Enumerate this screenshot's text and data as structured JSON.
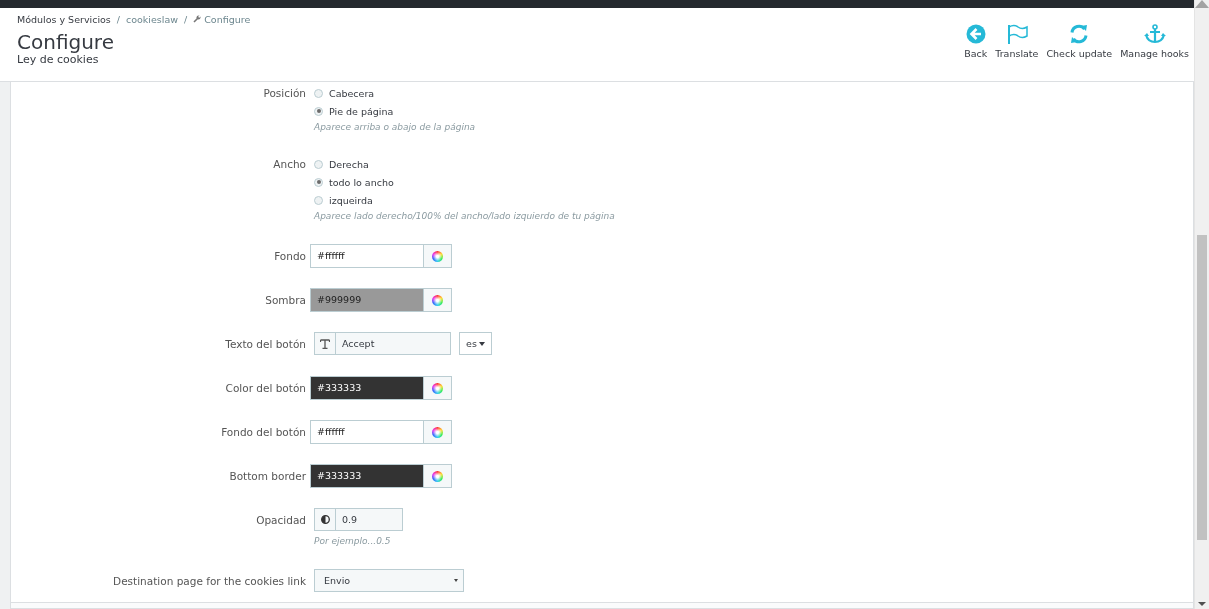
{
  "breadcrumb": [
    {
      "label": "Módulos y Servicios"
    },
    {
      "separator": "/",
      "label": "cookieslaw"
    },
    {
      "separator": "/",
      "label": "Configure",
      "kind": "wrench"
    }
  ],
  "page_title": "Configure",
  "page_subtitle": "Ley de cookies",
  "toolbar": [
    {
      "label": "Back",
      "kind": "back"
    },
    {
      "label": "Translate",
      "kind": "flag"
    },
    {
      "label": "Check update",
      "kind": "refresh"
    },
    {
      "label": "Manage hooks",
      "kind": "anchor"
    }
  ],
  "form": [
    {
      "kind": "radio",
      "label": "Posición",
      "options": [
        {
          "label": "Cabecera",
          "selected": false
        },
        {
          "label": "Pie de página",
          "selected": true
        }
      ],
      "help": "Aparece arriba o abajo de la página"
    },
    {
      "kind": "radio",
      "label": "Ancho",
      "options": [
        {
          "label": "Derecha",
          "selected": false
        },
        {
          "label": "todo lo ancho",
          "selected": true
        },
        {
          "label": "izqueirda",
          "selected": false
        }
      ],
      "help": "Aparece lado derecho/100% del ancho/lado izquierdo de tu página"
    },
    {
      "kind": "color",
      "label": "Fondo",
      "value": "#ffffff",
      "color": "#ffffff"
    },
    {
      "kind": "color",
      "label": "Sombra",
      "value": "#999999",
      "color": "#999999"
    },
    {
      "kind": "text",
      "label": "Texto del botón",
      "value": "Accept",
      "language": "es"
    },
    {
      "kind": "color",
      "label": "Color del botón",
      "value": "#333333",
      "color": "#333333"
    },
    {
      "kind": "color",
      "label": "Fondo del botón",
      "value": "#ffffff",
      "color": "#ffffff"
    },
    {
      "kind": "color",
      "label": "Bottom border",
      "value": "#333333",
      "color": "#333333"
    },
    {
      "kind": "number",
      "label": "Opacidad",
      "value": "0.9",
      "help": "Por ejemplo...0.5"
    },
    {
      "kind": "select",
      "label": "Destination page for the cookies link",
      "value": "Envio"
    }
  ]
}
